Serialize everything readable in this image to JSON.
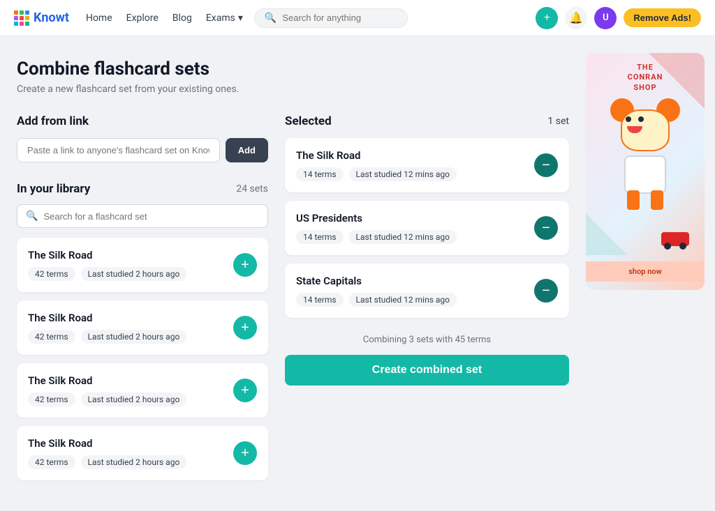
{
  "navbar": {
    "brand": "Knowt",
    "links": [
      {
        "label": "Home",
        "name": "home"
      },
      {
        "label": "Explore",
        "name": "explore"
      },
      {
        "label": "Blog",
        "name": "blog"
      },
      {
        "label": "Exams",
        "name": "exams",
        "dropdown": true
      }
    ],
    "search_placeholder": "Search for anything",
    "remove_ads_label": "Remove Ads!"
  },
  "page": {
    "title": "Combine flashcard sets",
    "subtitle": "Create a new flashcard set from your existing ones."
  },
  "add_from_link": {
    "section_title": "Add from link",
    "input_placeholder": "Paste a link to anyone's flashcard set on Knowt",
    "add_button": "Add"
  },
  "library": {
    "section_title": "In your library",
    "count": "24 sets",
    "search_placeholder": "Search for a flashcard set",
    "cards": [
      {
        "title": "The Silk Road",
        "terms": "42 terms",
        "last_studied": "Last studied 2 hours ago"
      },
      {
        "title": "The Silk Road",
        "terms": "42 terms",
        "last_studied": "Last studied 2 hours ago"
      },
      {
        "title": "The Silk Road",
        "terms": "42 terms",
        "last_studied": "Last studied 2 hours ago"
      },
      {
        "title": "The Silk Road",
        "terms": "42 terms",
        "last_studied": "Last studied 2 hours ago"
      }
    ]
  },
  "selected": {
    "section_title": "Selected",
    "count": "1 set",
    "cards": [
      {
        "title": "The Silk Road",
        "terms": "14 terms",
        "last_studied": "Last studied 12 mins ago"
      },
      {
        "title": "US Presidents",
        "terms": "14 terms",
        "last_studied": "Last studied 12 mins ago"
      },
      {
        "title": "State Capitals",
        "terms": "14 terms",
        "last_studied": "Last studied 12 mins ago"
      }
    ],
    "combine_info": "Combining 3 sets with 45 terms",
    "create_button": "Create combined set"
  },
  "ad": {
    "brand_line1": "THE",
    "brand_line2": "CONRAN",
    "brand_line3": "SHOP",
    "shop_now": "shop now"
  }
}
